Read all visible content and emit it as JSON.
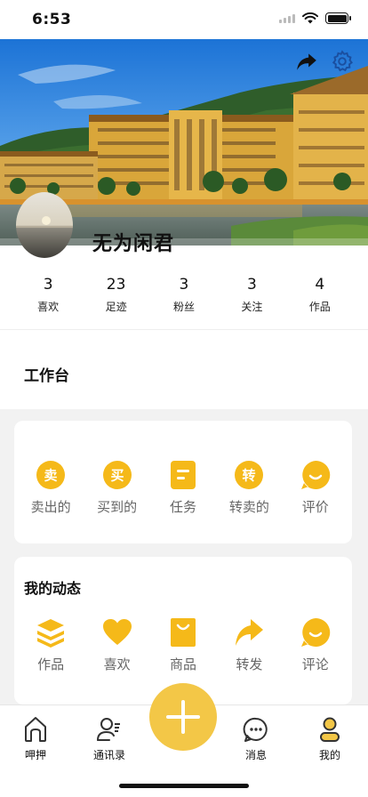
{
  "status_bar": {
    "time": "6:53"
  },
  "profile": {
    "username": "无为闲君"
  },
  "stats": [
    {
      "value": "3",
      "label": "喜欢"
    },
    {
      "value": "23",
      "label": "足迹"
    },
    {
      "value": "3",
      "label": "粉丝"
    },
    {
      "value": "3",
      "label": "关注"
    },
    {
      "value": "4",
      "label": "作品"
    }
  ],
  "workbench": {
    "title": "工作台"
  },
  "trade_card": {
    "items": [
      {
        "label": "卖出的",
        "glyph": "卖",
        "icon": "sell-icon"
      },
      {
        "label": "买到的",
        "glyph": "买",
        "icon": "buy-icon"
      },
      {
        "label": "任务",
        "icon": "task-icon"
      },
      {
        "label": "转卖的",
        "glyph": "转",
        "icon": "resell-icon"
      },
      {
        "label": "评价",
        "icon": "review-icon"
      }
    ]
  },
  "activity_card": {
    "title": "我的动态",
    "items": [
      {
        "label": "作品",
        "icon": "layers-icon"
      },
      {
        "label": "喜欢",
        "icon": "heart-icon"
      },
      {
        "label": "商品",
        "icon": "shopping-bag-icon"
      },
      {
        "label": "转发",
        "icon": "forward-icon"
      },
      {
        "label": "评论",
        "icon": "comment-icon"
      }
    ]
  },
  "tab_bar": {
    "tabs": [
      {
        "label": "呷押",
        "icon": "home-icon"
      },
      {
        "label": "通讯录",
        "icon": "contacts-icon"
      },
      {
        "label": "",
        "icon": "plus-icon"
      },
      {
        "label": "消息",
        "icon": "message-icon"
      },
      {
        "label": "我的",
        "icon": "profile-icon"
      }
    ]
  },
  "colors": {
    "accent": "#f5b919",
    "fab": "#f3c747",
    "background": "#f2f2f2"
  }
}
